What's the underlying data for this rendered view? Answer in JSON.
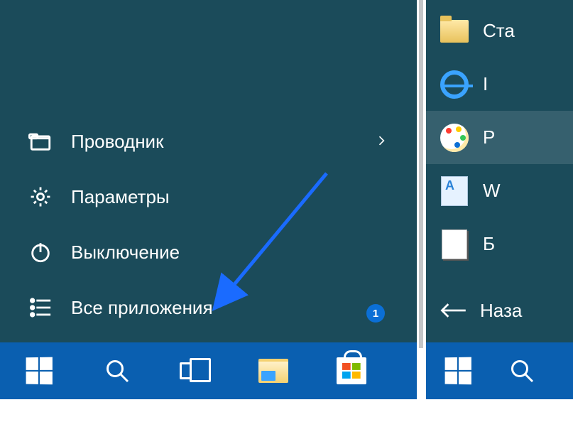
{
  "left_panel": {
    "items": [
      {
        "label": "Проводник",
        "icon": "file-explorer-icon",
        "has_chevron": true
      },
      {
        "label": "Параметры",
        "icon": "gear-icon",
        "has_chevron": false
      },
      {
        "label": "Выключение",
        "icon": "power-icon",
        "has_chevron": false
      },
      {
        "label": "Все приложения",
        "icon": "all-apps-icon",
        "has_chevron": false
      }
    ],
    "badge": "1"
  },
  "right_panel": {
    "apps": [
      {
        "label": "Ста",
        "icon": "folder"
      },
      {
        "label": "I",
        "icon": "ie"
      },
      {
        "label": "P",
        "icon": "paint"
      },
      {
        "label": "W",
        "icon": "wordpad"
      },
      {
        "label": "Б",
        "icon": "doc"
      }
    ],
    "back_label": "Наза"
  },
  "annotation": {
    "arrow_color": "#1a6bff"
  }
}
